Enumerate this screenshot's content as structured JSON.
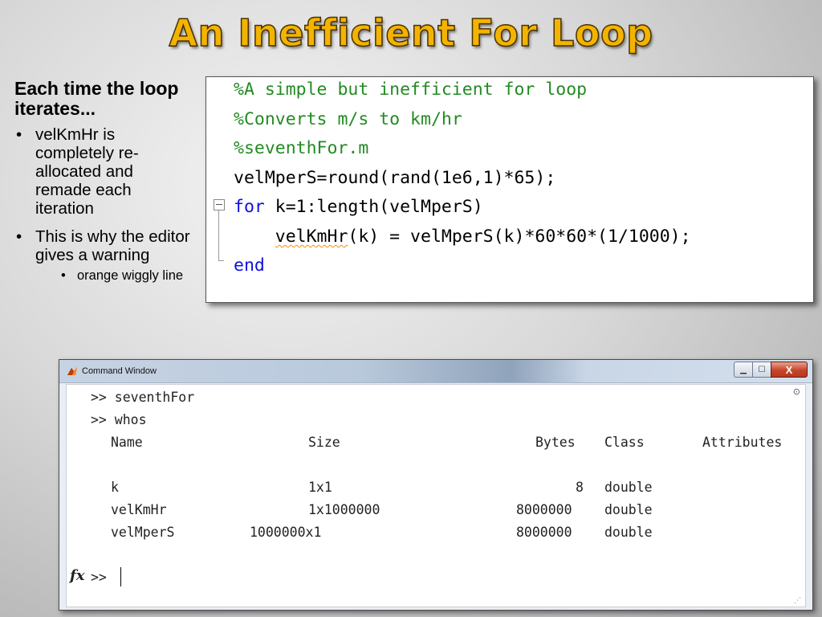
{
  "slide": {
    "title": "An Inefficient For Loop",
    "heading": "Each time the loop iterates...",
    "bullets": [
      "velKmHr is completely re-allocated and remade each iteration",
      "This is why the editor gives a warning"
    ],
    "sub_bullet": "orange wiggly line"
  },
  "editor": {
    "line1": "%A simple but inefficient for loop",
    "line2": "%Converts m/s to km/hr",
    "line3": "%seventhFor.m",
    "line4": "velMperS=round(rand(1e6,1)*65);",
    "line5_kw": "for",
    "line5_rest": " k=1:length(velMperS)",
    "line6_indent": "    ",
    "line6_var": "velKmHr",
    "line6_rest": "(k) = velMperS(k)*60*60*(1/1000);",
    "line7_kw": "end",
    "colors": {
      "comment": "#228b22",
      "keyword": "#1010e0",
      "warning": "#ff8c00"
    }
  },
  "command_window": {
    "title": "Command Window",
    "controls": {
      "minimize": "▁",
      "maximize": "☐",
      "close": "X"
    },
    "cmd1": ">> seventhFor",
    "cmd2": ">> whos",
    "headers": {
      "name": "Name",
      "size": "Size",
      "bytes": "Bytes",
      "class": "Class",
      "attributes": "Attributes"
    },
    "rows": [
      {
        "name": "k",
        "size": "1x1",
        "bytes": "8",
        "class": "double"
      },
      {
        "name": "velKmHr",
        "size": "1x1000000",
        "bytes": "8000000",
        "class": "double"
      },
      {
        "name": "velMperS",
        "size": "1000000x1",
        "bytes": "8000000",
        "class": "double"
      }
    ],
    "prompt": ">>",
    "fx_label": "fx",
    "scroll_glyph": "⊙",
    "grip_glyph": "⋰"
  }
}
